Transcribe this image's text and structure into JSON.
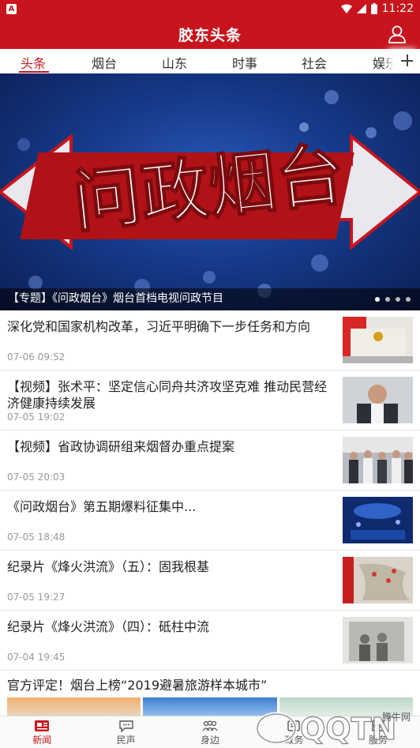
{
  "statusbar": {
    "time": "11:22"
  },
  "header": {
    "title": "胶东头条"
  },
  "tabs": [
    {
      "label": "头条",
      "active": true
    },
    {
      "label": "烟台"
    },
    {
      "label": "山东"
    },
    {
      "label": "时事"
    },
    {
      "label": "社会"
    },
    {
      "label": "娱乐"
    }
  ],
  "banner": {
    "art_text": "问政烟台",
    "caption": "【专题】《问政烟台》烟台首档电视问政节目",
    "slide_count": 4,
    "active_slide": 1
  },
  "news": [
    {
      "headline": "深化党和国家机构改革，习近平明确下一步任务和方向",
      "time": "07-06 09:52"
    },
    {
      "headline": "【视频】张术平：坚定信心同舟共济攻坚克难 推动民营经济健康持续发展",
      "time": "07-05 19:02"
    },
    {
      "headline": "【视频】省政协调研组来烟督办重点提案",
      "time": "07-05 20:03"
    },
    {
      "headline": "《问政烟台》第五期爆料征集中...",
      "time": "07-05 18:48"
    },
    {
      "headline": "纪录片《烽火洪流》（五）：固我根基",
      "time": "07-05 19:27"
    },
    {
      "headline": "纪录片《烽火洪流》（四）：砥柱中流",
      "time": "07-04 19:45"
    },
    {
      "headline": "官方评定！烟台上榜“2019避暑旅游样本城市”"
    }
  ],
  "bottomnav": [
    {
      "label": "新闻",
      "icon": "news-icon",
      "active": true
    },
    {
      "label": "民声",
      "icon": "chat-icon"
    },
    {
      "label": "身边",
      "icon": "people-icon"
    },
    {
      "label": "政务",
      "icon": "gov-icon"
    },
    {
      "label": "服务",
      "icon": "service-icon"
    }
  ],
  "watermark": {
    "brand": "QQTN",
    "tag": "腾牛网"
  },
  "colors": {
    "brand_red": "#c8151d",
    "banner_blue": "#163a8a"
  }
}
